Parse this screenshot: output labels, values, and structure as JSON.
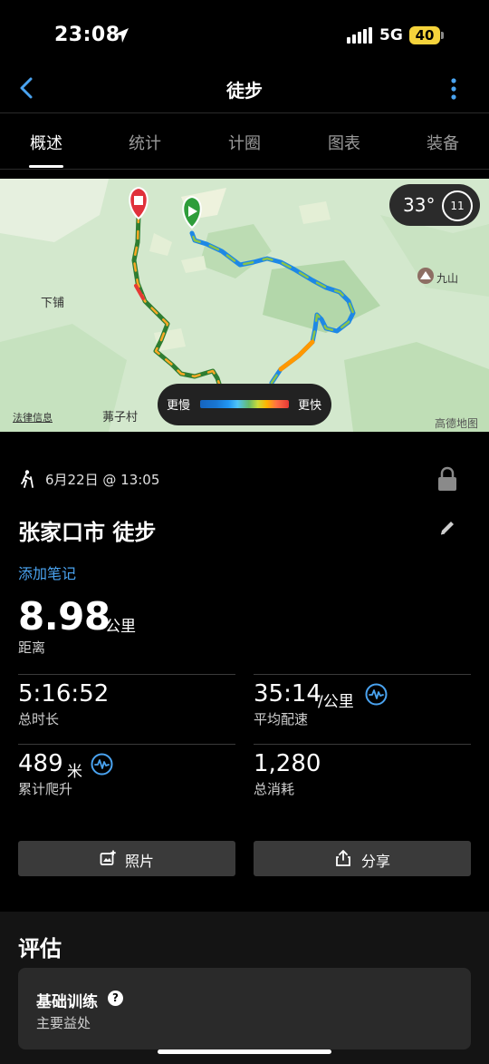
{
  "status_bar": {
    "time": "23:08",
    "network": "5G",
    "battery": "40"
  },
  "header": {
    "title": "徒步"
  },
  "tabs": [
    {
      "label": "概述",
      "active": true
    },
    {
      "label": "统计",
      "active": false
    },
    {
      "label": "计圈",
      "active": false
    },
    {
      "label": "图表",
      "active": false
    },
    {
      "label": "装备",
      "active": false
    }
  ],
  "map": {
    "labels": {
      "village_a": "下铺",
      "village_b": "茀子村",
      "mountain": "九山",
      "legal": "法律信息",
      "provider": "高德地图"
    },
    "temperature": "33°",
    "wind": "11",
    "legend": {
      "slow": "更慢",
      "fast": "更快"
    }
  },
  "activity": {
    "date": "6月22日 @ 13:05",
    "title": "张家口市 徒步",
    "add_note": "添加笔记"
  },
  "stats": {
    "distance": {
      "value": "8.98",
      "unit": "公里",
      "label": "距离"
    },
    "total_time": {
      "value": "5:16:52",
      "label": "总时长"
    },
    "avg_pace": {
      "value": "35:14",
      "unit": "/公里",
      "label": "平均配速"
    },
    "ascent": {
      "value": "489",
      "unit": "米",
      "label": "累计爬升"
    },
    "calories": {
      "value": "1,280",
      "label": "总消耗"
    }
  },
  "buttons": {
    "photos": "照片",
    "share": "分享"
  },
  "evaluation": {
    "title": "评估",
    "card_title": "基础训练",
    "card_subtitle": "主要益处"
  },
  "colors": {
    "accent": "#4aa3f0",
    "battery": "#f5d33b",
    "start_marker": "#2e9d3a",
    "end_marker": "#e0313b"
  }
}
